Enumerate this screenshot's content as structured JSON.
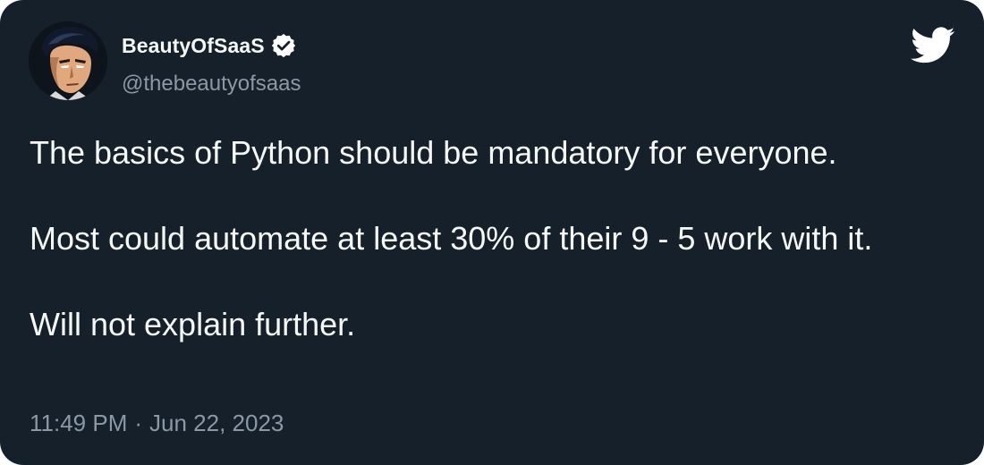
{
  "author": {
    "display_name": "BeautyOfSaaS",
    "handle": "@thebeautyofsaas",
    "verified_icon": "verified-badge-icon",
    "avatar_icon": "comic-portrait-avatar"
  },
  "brand": {
    "icon": "twitter-bird-icon",
    "color": "#ffffff"
  },
  "tweet": {
    "paragraphs": [
      "The basics of Python should be mandatory for everyone.",
      "Most could automate at least 30% of their 9 - 5 work with it.",
      "Will not explain further."
    ]
  },
  "meta": {
    "time": "11:49 PM",
    "separator": "·",
    "date": "Jun 22, 2023"
  },
  "colors": {
    "background": "#15202b",
    "text": "#f7f9f9",
    "muted": "#8b98a5"
  }
}
